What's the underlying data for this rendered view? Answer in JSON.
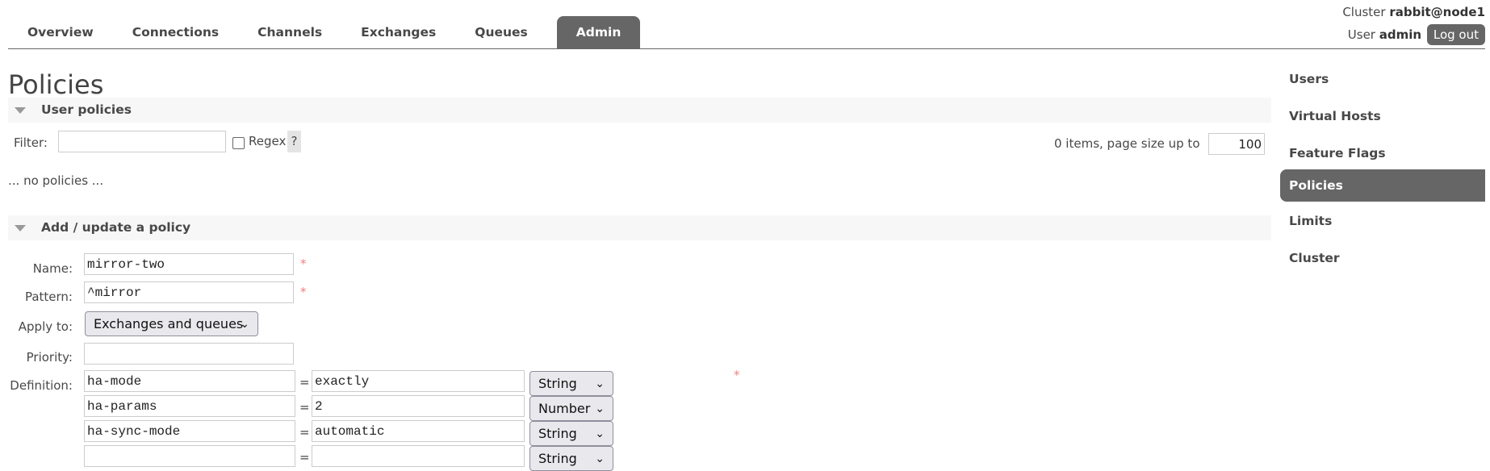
{
  "nav": {
    "tabs": [
      {
        "label": "Overview"
      },
      {
        "label": "Connections"
      },
      {
        "label": "Channels"
      },
      {
        "label": "Exchanges"
      },
      {
        "label": "Queues"
      },
      {
        "label": "Admin",
        "active": true
      }
    ]
  },
  "header": {
    "cluster_label": "Cluster",
    "cluster_name": "rabbit@node1",
    "user_label": "User",
    "user_name": "admin",
    "logout": "Log out"
  },
  "page": {
    "title": "Policies"
  },
  "user_policies": {
    "title": "User policies",
    "filter_label": "Filter:",
    "filter_value": "",
    "regex_label": "Regex",
    "regex_checked": false,
    "help": "?",
    "items_text": "0 items, page size up to",
    "page_size": "100",
    "empty_text": "... no policies ..."
  },
  "add_policy": {
    "title": "Add / update a policy",
    "name_label": "Name:",
    "name_value": "mirror-two",
    "pattern_label": "Pattern:",
    "pattern_value": "^mirror",
    "apply_label": "Apply to:",
    "apply_value": "Exchanges and queues",
    "priority_label": "Priority:",
    "priority_value": "",
    "definition_label": "Definition:",
    "required_mark": "*",
    "equals": "=",
    "definition": [
      {
        "key": "ha-mode",
        "value": "exactly",
        "type": "String"
      },
      {
        "key": "ha-params",
        "value": "2",
        "type": "Number"
      },
      {
        "key": "ha-sync-mode",
        "value": "automatic",
        "type": "String"
      },
      {
        "key": "",
        "value": "",
        "type": "String"
      }
    ]
  },
  "sidebar": {
    "items": [
      {
        "label": "Users"
      },
      {
        "label": "Virtual Hosts"
      },
      {
        "label": "Feature Flags"
      },
      {
        "label": "Policies",
        "active": true
      },
      {
        "label": "Limits"
      },
      {
        "label": "Cluster"
      }
    ]
  },
  "colors": {
    "accent": "#666666",
    "required": "#f08080",
    "section_bg": "#f7f7f7"
  }
}
